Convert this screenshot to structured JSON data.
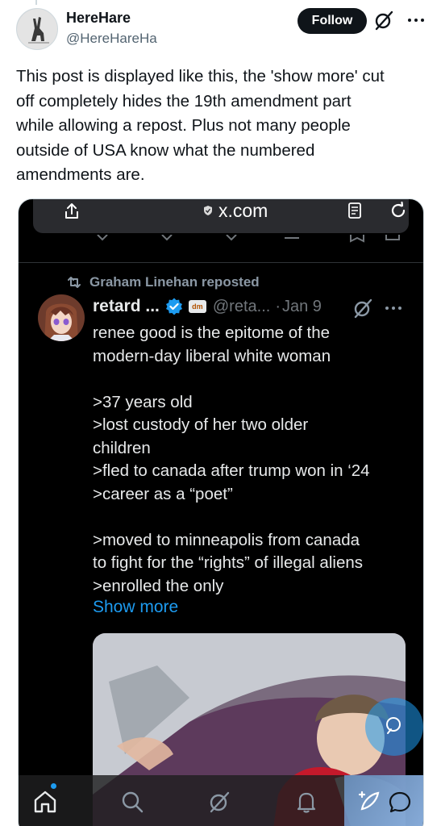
{
  "post": {
    "display_name": "HereHare",
    "handle": "@HereHareHa",
    "follow_label": "Follow",
    "text_lines": [
      "This post is displayed like this, the 'show more' cut",
      "off completely hides the 19th amendment part",
      "while allowing a repost. Plus not many people",
      "outside of USA know what the numbered",
      "amendments are."
    ]
  },
  "screenshot": {
    "browser": {
      "url": "x.com"
    },
    "repost_label": "Graham Linehan reposted",
    "tweet": {
      "name": "retard ...",
      "badge": "dm",
      "handle": "@reta...",
      "separator": "·",
      "date": "Jan 9",
      "lines": [
        "renee good is the epitome of the",
        "modern-day liberal white woman",
        "",
        ">37 years old",
        ">lost custody of her two older",
        "children",
        ">fled to canada after trump won in ‘24",
        ">career as a “poet”",
        "",
        ">moved to minneapolis from canada",
        "to fight for the “rights” of illegal aliens",
        ">enrolled the only"
      ],
      "show_more": "Show more"
    }
  },
  "colors": {
    "accent": "#1d9bf0",
    "text_dark": "#0f1419",
    "muted": "#536471",
    "dark_bg": "#000000",
    "dark_text": "#e7e9ea"
  },
  "icons": [
    "grok-icon",
    "more-icon",
    "share-icon",
    "lock-icon",
    "reader-icon",
    "reload-icon",
    "repost-icon",
    "verified-icon",
    "home-icon",
    "search-icon",
    "grok-nav-icon",
    "notifications-icon",
    "compose-icon",
    "messages-icon"
  ]
}
